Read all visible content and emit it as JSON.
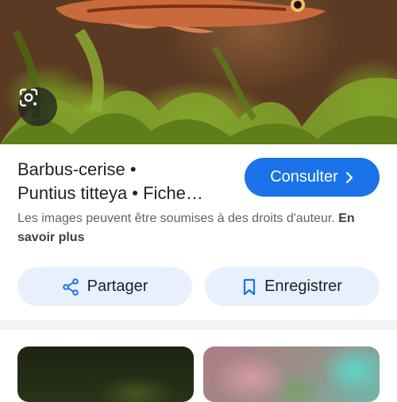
{
  "result": {
    "title_line1": "Barbus-cerise •",
    "title_line2": "Puntius titteya • Fiche…",
    "visit_label": "Consulter",
    "notice_text": "Les images peuvent être soumises à des droits d'auteur.",
    "notice_link": "En savoir plus"
  },
  "actions": {
    "share_label": "Partager",
    "save_label": "Enregistrer"
  },
  "icons": {
    "lens": "google-lens-icon",
    "share": "share-icon",
    "bookmark": "bookmark-icon",
    "chevron": "chevron-right-icon"
  },
  "colors": {
    "accent": "#1a73e8",
    "pill_bg": "#e8f0fe",
    "text_primary": "#202124",
    "text_secondary": "#5f6368"
  }
}
